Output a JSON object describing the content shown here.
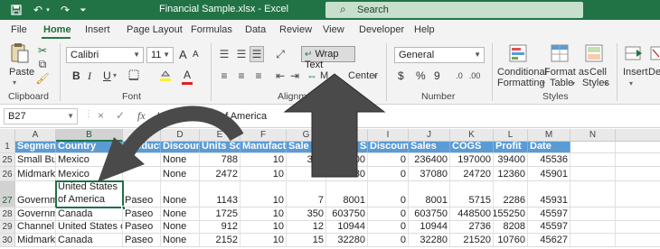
{
  "titlebar": {
    "title": "Financial Sample.xlsx  -  Excel",
    "search_placeholder": "Search",
    "search_icon": "search-icon",
    "save_icon": "save-icon",
    "undo_icon": "undo-icon",
    "redo_icon": "redo-icon",
    "customize_icon": "customize-qat-icon"
  },
  "menu": {
    "tabs": [
      {
        "label": "File"
      },
      {
        "label": "Home"
      },
      {
        "label": "Insert"
      },
      {
        "label": "Page Layout"
      },
      {
        "label": "Formulas"
      },
      {
        "label": "Data"
      },
      {
        "label": "Review"
      },
      {
        "label": "View"
      },
      {
        "label": "Developer"
      },
      {
        "label": "Help"
      }
    ],
    "active": "Home"
  },
  "ribbon": {
    "clipboard": {
      "paste_label": "Paste",
      "group_label": "Clipboard"
    },
    "font": {
      "font_name": "Calibri",
      "font_size": "11",
      "bold": "B",
      "italic": "I",
      "underline": "U",
      "grow": "A",
      "shrink": "A",
      "font_color": "A",
      "group_label": "Font"
    },
    "alignment": {
      "wrap_text": "Wrap Text",
      "merge_center": "Merge & Center",
      "merge_visible": "M",
      "merge_tail": "Center",
      "group_label": "Alignm"
    },
    "number": {
      "format": "General",
      "currency": "$",
      "percent": "%",
      "comma": "9",
      "group_label": "Number"
    },
    "styles": {
      "conditional_formatting": [
        "Conditional",
        "Formatting"
      ],
      "format_as_table": [
        "Format as",
        "Table"
      ],
      "cell_styles": [
        "Cell",
        "Styles"
      ],
      "group_label": "Styles"
    },
    "cells": {
      "insert": "Insert",
      "delete": "Dele"
    }
  },
  "formula_bar": {
    "name_box": "B27",
    "cancel_icon": "×",
    "enter_icon": "✓",
    "fx": "fx",
    "content": "United States of America"
  },
  "grid": {
    "columns": [
      "A",
      "B",
      "C",
      "D",
      "E",
      "F",
      "G",
      "H",
      "I",
      "J",
      "K",
      "L",
      "M",
      "N"
    ],
    "selected_column": "B",
    "rows": [
      {
        "num": "1",
        "cells": [
          "Segment",
          "Country",
          "Product",
          "Discount",
          "Units Sold",
          "Manufactu",
          "Sale Price",
          "Gross Sal",
          "Discounts",
          "Sales",
          "COGS",
          "Profit",
          "Date",
          ""
        ]
      },
      {
        "num": "25",
        "cells": [
          "Small Busi",
          "Mexico",
          "",
          "None",
          "788",
          "10",
          "300",
          "236400",
          "0",
          "236400",
          "197000",
          "39400",
          "45536",
          ""
        ]
      },
      {
        "num": "26",
        "cells": [
          "Midmarke",
          "Mexico",
          "",
          "None",
          "2472",
          "10",
          "15",
          "37080",
          "0",
          "37080",
          "24720",
          "12360",
          "45901",
          ""
        ]
      },
      {
        "num": "27",
        "cells": [
          "Governm",
          "United States of America",
          "Paseo",
          "None",
          "1143",
          "10",
          "7",
          "8001",
          "0",
          "8001",
          "5715",
          "2286",
          "45931",
          ""
        ]
      },
      {
        "num": "28",
        "cells": [
          "Governm",
          "Canada",
          "Paseo",
          "None",
          "1725",
          "10",
          "350",
          "603750",
          "0",
          "603750",
          "448500",
          "155250",
          "45597",
          ""
        ]
      },
      {
        "num": "29",
        "cells": [
          "Channel P",
          "United States o",
          "Paseo",
          "None",
          "912",
          "10",
          "12",
          "10944",
          "0",
          "10944",
          "2736",
          "8208",
          "45597",
          ""
        ]
      },
      {
        "num": "30",
        "cells": [
          "Midmarke",
          "Canada",
          "Paseo",
          "None",
          "2152",
          "10",
          "15",
          "32280",
          "0",
          "32280",
          "21520",
          "10760",
          "45627",
          ""
        ]
      }
    ],
    "wrapped_lines": [
      "United States",
      "of America"
    ],
    "selected_row": "27",
    "header_fill": "#5b9bd5"
  },
  "annotations": {
    "arrow_color": "#4a4a4a"
  }
}
